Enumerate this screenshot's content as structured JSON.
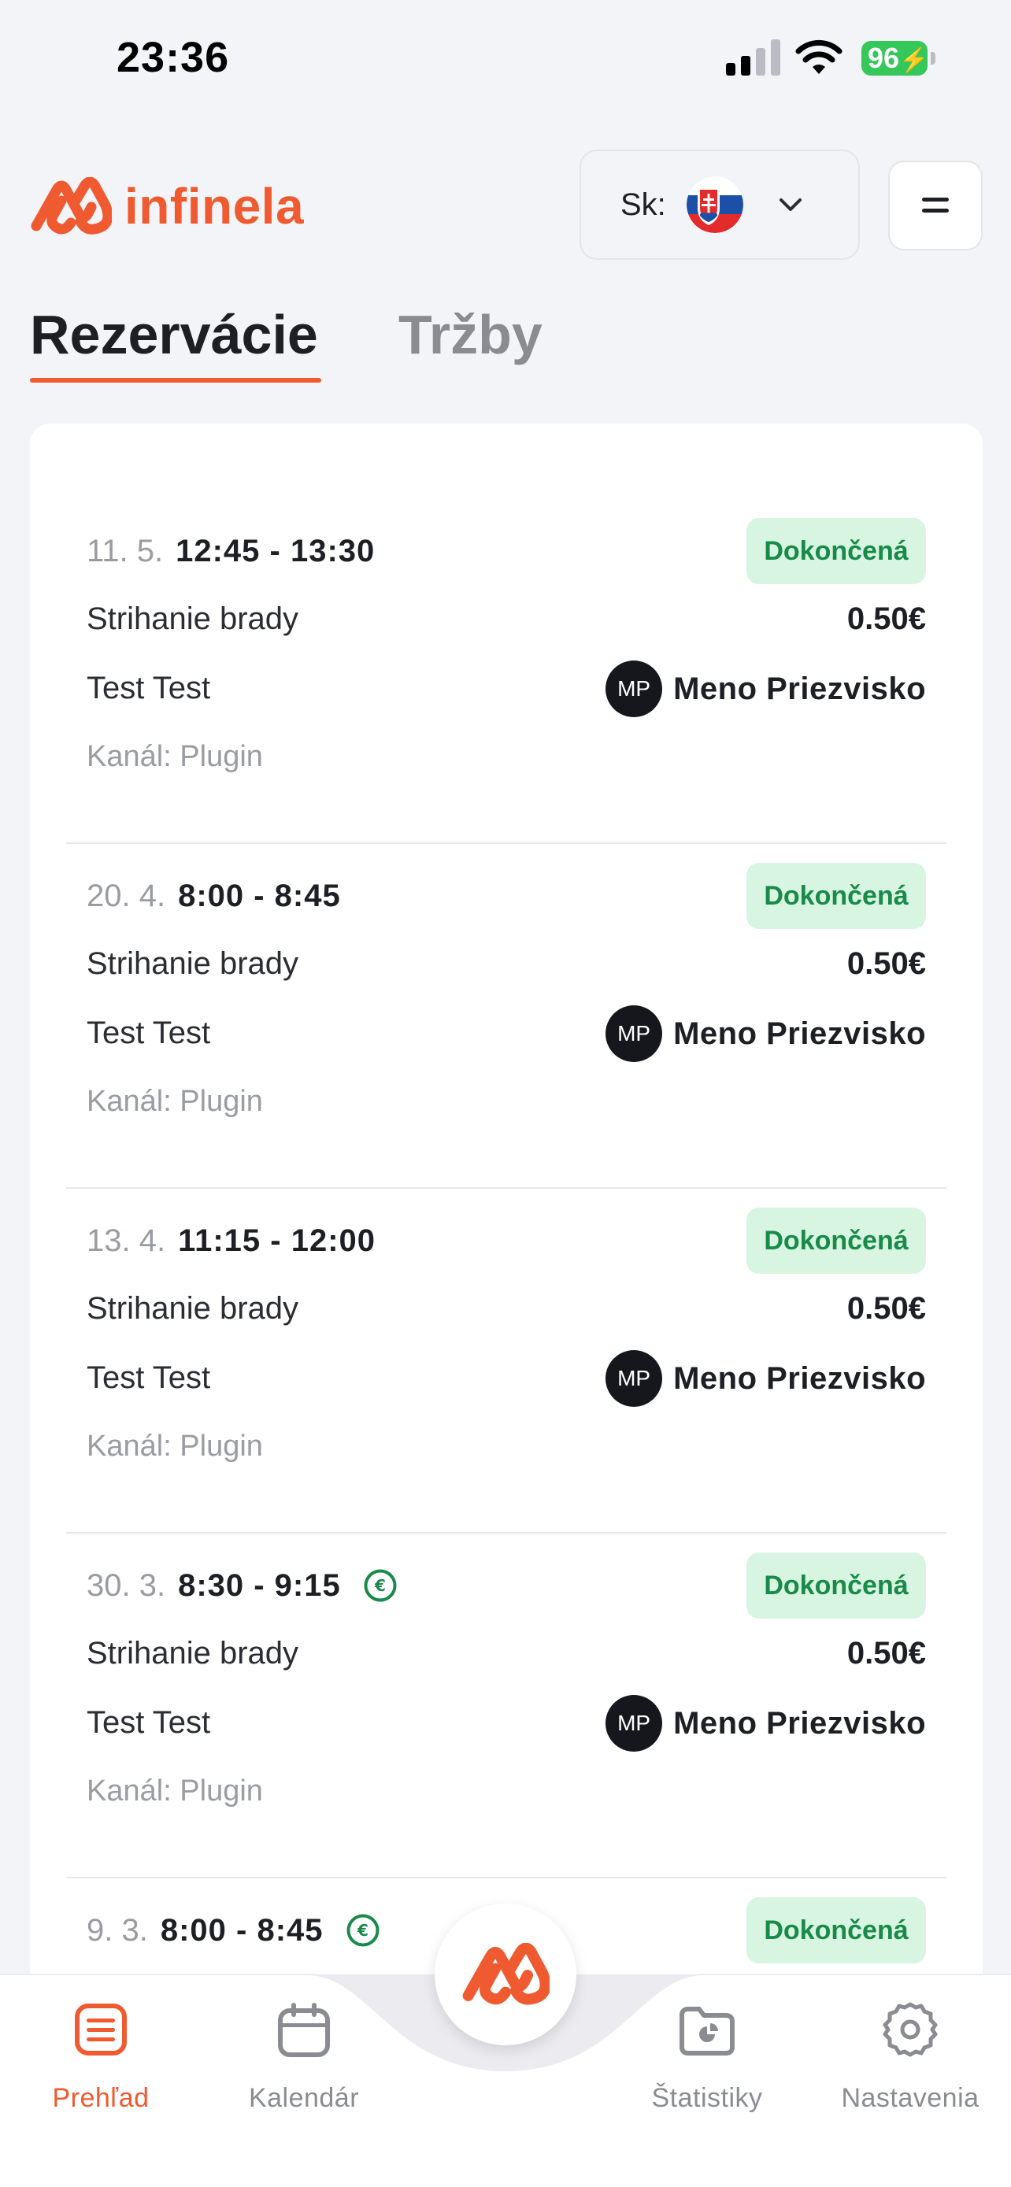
{
  "status_bar": {
    "time": "23:36",
    "battery": "96"
  },
  "header": {
    "logo_text": "infinela",
    "language_label": "Sk:",
    "language_flag": "slovak-flag"
  },
  "tabs": [
    {
      "label": "Rezervácie",
      "active": true
    },
    {
      "label": "Tržby",
      "active": false
    }
  ],
  "reservations": [
    {
      "date": "11. 5.",
      "time": "12:45 - 13:30",
      "paid": false,
      "status": "Dokončená",
      "service": "Strihanie brady",
      "price": "0.50€",
      "client": "Test Test",
      "staff_initials": "MP",
      "staff_name": "Meno Priezvisko",
      "channel": "Kanál: Plugin"
    },
    {
      "date": "20. 4.",
      "time": "8:00 - 8:45",
      "paid": false,
      "status": "Dokončená",
      "service": "Strihanie brady",
      "price": "0.50€",
      "client": "Test Test",
      "staff_initials": "MP",
      "staff_name": "Meno Priezvisko",
      "channel": "Kanál: Plugin"
    },
    {
      "date": "13. 4.",
      "time": "11:15 - 12:00",
      "paid": false,
      "status": "Dokončená",
      "service": "Strihanie brady",
      "price": "0.50€",
      "client": "Test Test",
      "staff_initials": "MP",
      "staff_name": "Meno Priezvisko",
      "channel": "Kanál: Plugin"
    },
    {
      "date": "30. 3.",
      "time": "8:30 - 9:15",
      "paid": true,
      "status": "Dokončená",
      "service": "Strihanie brady",
      "price": "0.50€",
      "client": "Test Test",
      "staff_initials": "MP",
      "staff_name": "Meno Priezvisko",
      "channel": "Kanál: Plugin"
    },
    {
      "date": "9. 3.",
      "time": "8:00 - 8:45",
      "paid": true,
      "status": "Dokončená"
    }
  ],
  "bottom_nav": [
    {
      "label": "Prehľad",
      "icon": "list-icon",
      "active": true
    },
    {
      "label": "Kalendár",
      "icon": "calendar-icon",
      "active": false
    },
    {
      "label": "Štatistiky",
      "icon": "stats-folder-icon",
      "active": false
    },
    {
      "label": "Nastavenia",
      "icon": "gear-icon",
      "active": false
    }
  ],
  "colors": {
    "accent": "#f05a30",
    "badge_bg": "#d8f5e1",
    "badge_text": "#188a49",
    "battery": "#35c759"
  }
}
